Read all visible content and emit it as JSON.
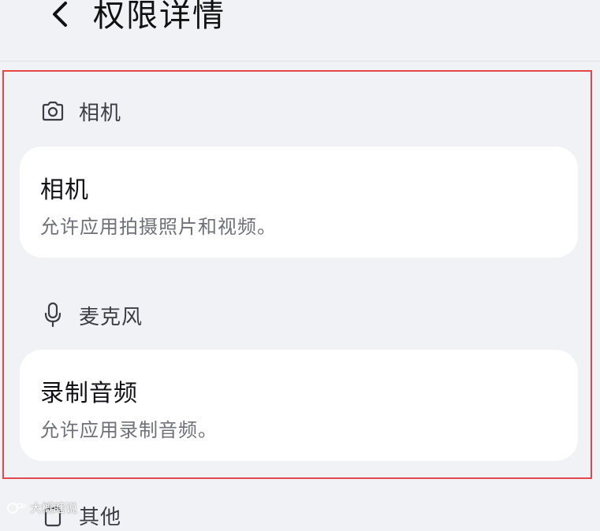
{
  "header": {
    "title": "权限详情",
    "back_icon": "chevron-left-icon"
  },
  "sections": [
    {
      "icon": "camera-icon",
      "label": "相机",
      "card": {
        "title": "相机",
        "description": "允许应用拍摄照片和视频。"
      }
    },
    {
      "icon": "microphone-icon",
      "label": "麦克风",
      "card": {
        "title": "录制音频",
        "description": "允许应用录制音频。"
      }
    },
    {
      "icon": "other-icon",
      "label": "其他"
    }
  ],
  "watermark": {
    "text": "大概瞎说"
  },
  "colors": {
    "background": "#f1f2f6",
    "card": "#ffffff",
    "highlight_border": "#e2474b",
    "secondary_text": "#707178"
  }
}
